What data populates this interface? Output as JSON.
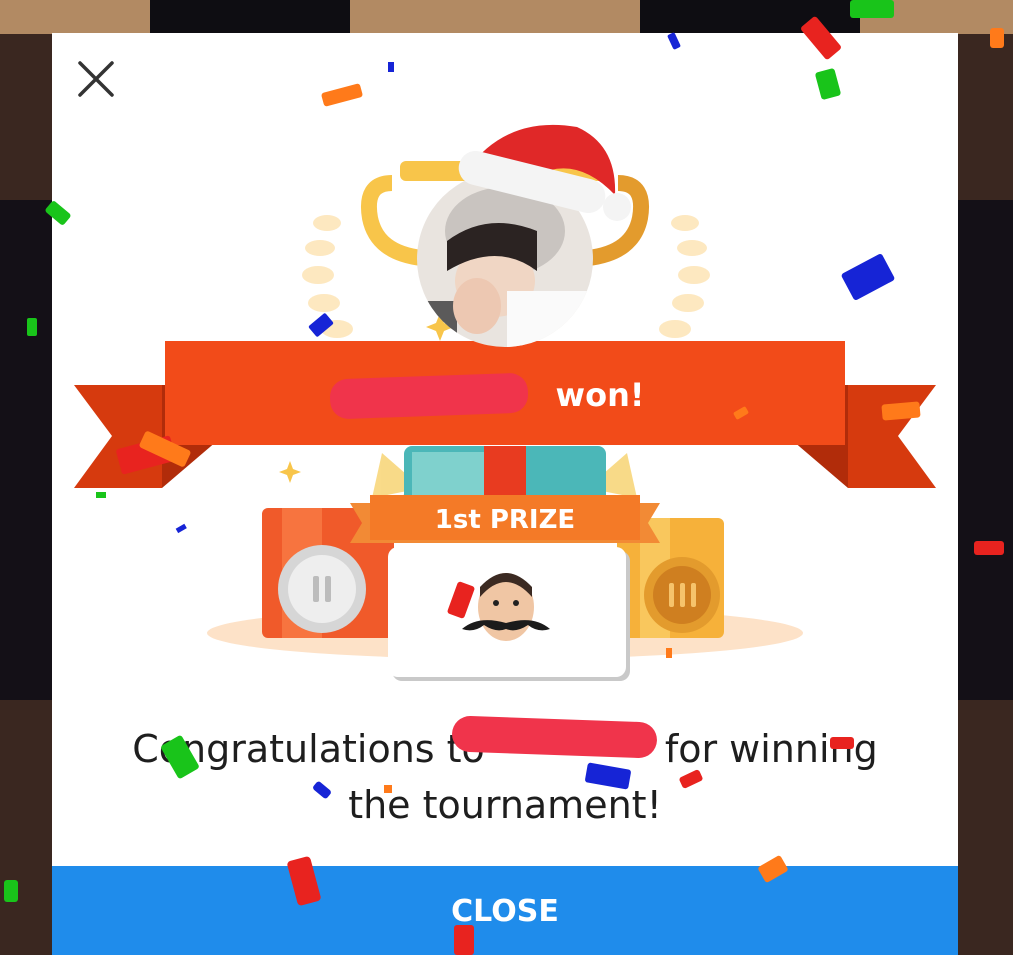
{
  "dialog": {
    "winner_suffix": "won!",
    "prize_label": "1st PRIZE",
    "message_line1_start": "Congratulations to",
    "message_line1_end": "for winning",
    "message_line2": "the tournament!",
    "close_label": "CLOSE"
  },
  "icons": {
    "close": "close-icon",
    "trophy": "trophy-icon",
    "silver_medal": "silver-medal-icon",
    "bronze_medal": "bronze-medal-icon",
    "gift": "gift-box-icon"
  },
  "colors": {
    "ribbon": "#f24b19",
    "ribbon_dark": "#d63a0e",
    "close_button": "#1f8ceb",
    "redaction": "#f0344b"
  }
}
